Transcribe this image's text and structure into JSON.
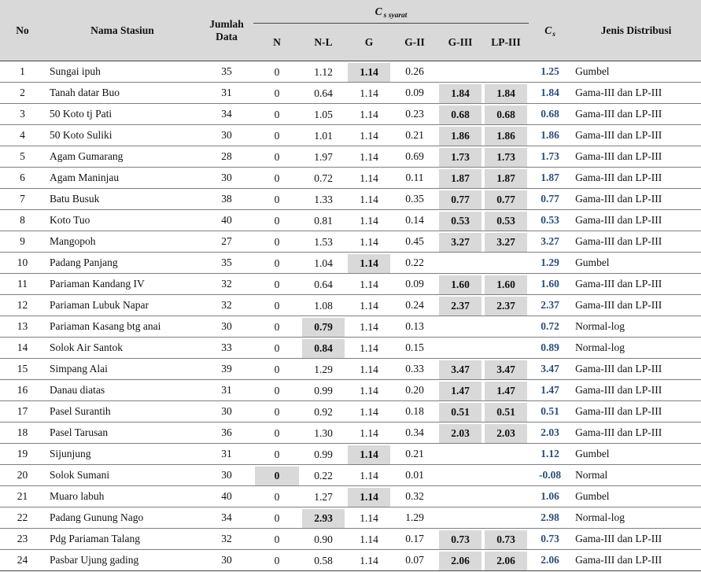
{
  "header": {
    "no": "No",
    "nama": "Nama Stasiun",
    "jumlah_line1": "Jumlah",
    "jumlah_line2": "Data",
    "cs_syarat_main": "C",
    "cs_syarat_sub": "s syarat",
    "n": "N",
    "nl": "N-L",
    "g": "G",
    "gii": "G-II",
    "giii": "G-III",
    "lpiii": "LP-III",
    "cs_main": "C",
    "cs_sub": "s",
    "jenis": "Jenis Distribusi"
  },
  "rows": [
    {
      "no": "1",
      "nama": "Sungai ipuh",
      "jumlah": "35",
      "n": "0",
      "nl": "1.12",
      "g": "1.14",
      "gii": "0.26",
      "giii": "",
      "lpiii": "",
      "cs": "1.25",
      "jenis": "Gumbel",
      "hl": [
        "g"
      ]
    },
    {
      "no": "2",
      "nama": "Tanah datar Buo",
      "jumlah": "31",
      "n": "0",
      "nl": "0.64",
      "g": "1.14",
      "gii": "0.09",
      "giii": "1.84",
      "lpiii": "1.84",
      "cs": "1.84",
      "jenis": "Gama-III dan LP-III",
      "hl": [
        "giii",
        "lpiii"
      ]
    },
    {
      "no": "3",
      "nama": "50 Koto tj Pati",
      "jumlah": "34",
      "n": "0",
      "nl": "1.05",
      "g": "1.14",
      "gii": "0.23",
      "giii": "0.68",
      "lpiii": "0.68",
      "cs": "0.68",
      "jenis": "Gama-III dan LP-III",
      "hl": [
        "giii",
        "lpiii"
      ]
    },
    {
      "no": "4",
      "nama": "50 Koto Suliki",
      "jumlah": "30",
      "n": "0",
      "nl": "1.01",
      "g": "1.14",
      "gii": "0.21",
      "giii": "1.86",
      "lpiii": "1.86",
      "cs": "1.86",
      "jenis": "Gama-III dan LP-III",
      "hl": [
        "giii",
        "lpiii"
      ]
    },
    {
      "no": "5",
      "nama": "Agam Gumarang",
      "jumlah": "28",
      "n": "0",
      "nl": "1.97",
      "g": "1.14",
      "gii": "0.69",
      "giii": "1.73",
      "lpiii": "1.73",
      "cs": "1.73",
      "jenis": "Gama-III dan LP-III",
      "hl": [
        "giii",
        "lpiii"
      ]
    },
    {
      "no": "6",
      "nama": "Agam Maninjau",
      "jumlah": "30",
      "n": "0",
      "nl": "0.72",
      "g": "1.14",
      "gii": "0.11",
      "giii": "1.87",
      "lpiii": "1.87",
      "cs": "1.87",
      "jenis": "Gama-III dan LP-III",
      "hl": [
        "giii",
        "lpiii"
      ]
    },
    {
      "no": "7",
      "nama": "Batu Busuk",
      "jumlah": "38",
      "n": "0",
      "nl": "1.33",
      "g": "1.14",
      "gii": "0.35",
      "giii": "0.77",
      "lpiii": "0.77",
      "cs": "0.77",
      "jenis": "Gama-III dan LP-III",
      "hl": [
        "giii",
        "lpiii"
      ]
    },
    {
      "no": "8",
      "nama": "Koto Tuo",
      "jumlah": "40",
      "n": "0",
      "nl": "0.81",
      "g": "1.14",
      "gii": "0.14",
      "giii": "0.53",
      "lpiii": "0.53",
      "cs": "0.53",
      "jenis": "Gama-III dan LP-III",
      "hl": [
        "giii",
        "lpiii"
      ]
    },
    {
      "no": "9",
      "nama": "Mangopoh",
      "jumlah": "27",
      "n": "0",
      "nl": "1.53",
      "g": "1.14",
      "gii": "0.45",
      "giii": "3.27",
      "lpiii": "3.27",
      "cs": "3.27",
      "jenis": "Gama-III dan LP-III",
      "hl": [
        "giii",
        "lpiii"
      ]
    },
    {
      "no": "10",
      "nama": "Padang Panjang",
      "jumlah": "35",
      "n": "0",
      "nl": "1.04",
      "g": "1.14",
      "gii": "0.22",
      "giii": "",
      "lpiii": "",
      "cs": "1.29",
      "jenis": "Gumbel",
      "hl": [
        "g"
      ]
    },
    {
      "no": "11",
      "nama": "Pariaman Kandang IV",
      "jumlah": "32",
      "n": "0",
      "nl": "0.64",
      "g": "1.14",
      "gii": "0.09",
      "giii": "1.60",
      "lpiii": "1.60",
      "cs": "1.60",
      "jenis": "Gama-III dan LP-III",
      "hl": [
        "giii",
        "lpiii"
      ]
    },
    {
      "no": "12",
      "nama": "Pariaman Lubuk Napar",
      "jumlah": "32",
      "n": "0",
      "nl": "1.08",
      "g": "1.14",
      "gii": "0.24",
      "giii": "2.37",
      "lpiii": "2.37",
      "cs": "2.37",
      "jenis": "Gama-III dan LP-III",
      "hl": [
        "giii",
        "lpiii"
      ]
    },
    {
      "no": "13",
      "nama": "Pariaman Kasang btg anai",
      "jumlah": "30",
      "n": "0",
      "nl": "0.79",
      "g": "1.14",
      "gii": "0.13",
      "giii": "",
      "lpiii": "",
      "cs": "0.72",
      "jenis": "Normal-log",
      "hl": [
        "nl"
      ]
    },
    {
      "no": "14",
      "nama": "Solok Air Santok",
      "jumlah": "33",
      "n": "0",
      "nl": "0.84",
      "g": "1.14",
      "gii": "0.15",
      "giii": "",
      "lpiii": "",
      "cs": "0.89",
      "jenis": "Normal-log",
      "hl": [
        "nl"
      ]
    },
    {
      "no": "15",
      "nama": "Simpang Alai",
      "jumlah": "39",
      "n": "0",
      "nl": "1.29",
      "g": "1.14",
      "gii": "0.33",
      "giii": "3.47",
      "lpiii": "3.47",
      "cs": "3.47",
      "jenis": "Gama-III dan LP-III",
      "hl": [
        "giii",
        "lpiii"
      ]
    },
    {
      "no": "16",
      "nama": "Danau diatas",
      "jumlah": "31",
      "n": "0",
      "nl": "0.99",
      "g": "1.14",
      "gii": "0.20",
      "giii": "1.47",
      "lpiii": "1.47",
      "cs": "1.47",
      "jenis": "Gama-III dan LP-III",
      "hl": [
        "giii",
        "lpiii"
      ]
    },
    {
      "no": "17",
      "nama": "Pasel Surantih",
      "jumlah": "30",
      "n": "0",
      "nl": "0.92",
      "g": "1.14",
      "gii": "0.18",
      "giii": "0.51",
      "lpiii": "0.51",
      "cs": "0.51",
      "jenis": "Gama-III dan LP-III",
      "hl": [
        "giii",
        "lpiii"
      ]
    },
    {
      "no": "18",
      "nama": "Pasel Tarusan",
      "jumlah": "36",
      "n": "0",
      "nl": "1.30",
      "g": "1.14",
      "gii": "0.34",
      "giii": "2.03",
      "lpiii": "2.03",
      "cs": "2.03",
      "jenis": "Gama-III dan LP-III",
      "hl": [
        "giii",
        "lpiii"
      ]
    },
    {
      "no": "19",
      "nama": "Sijunjung",
      "jumlah": "31",
      "n": "0",
      "nl": "0.99",
      "g": "1.14",
      "gii": "0.21",
      "giii": "",
      "lpiii": "",
      "cs": "1.12",
      "jenis": "Gumbel",
      "hl": [
        "g"
      ]
    },
    {
      "no": "20",
      "nama": "Solok Sumani",
      "jumlah": "30",
      "n": "0",
      "nl": "0.22",
      "g": "1.14",
      "gii": "0.01",
      "giii": "",
      "lpiii": "",
      "cs": "-0.08",
      "jenis": "Normal",
      "hl": [
        "n"
      ]
    },
    {
      "no": "21",
      "nama": "Muaro labuh",
      "jumlah": "40",
      "n": "0",
      "nl": "1.27",
      "g": "1.14",
      "gii": "0.32",
      "giii": "",
      "lpiii": "",
      "cs": "1.06",
      "jenis": "Gumbel",
      "hl": [
        "g"
      ]
    },
    {
      "no": "22",
      "nama": "Padang Gunung Nago",
      "jumlah": "34",
      "n": "0",
      "nl": "2.93",
      "g": "1.14",
      "gii": "1.29",
      "giii": "",
      "lpiii": "",
      "cs": "2.98",
      "jenis": "Normal-log",
      "hl": [
        "nl"
      ]
    },
    {
      "no": "23",
      "nama": "Pdg Pariaman Talang",
      "jumlah": "32",
      "n": "0",
      "nl": "0.90",
      "g": "1.14",
      "gii": "0.17",
      "giii": "0.73",
      "lpiii": "0.73",
      "cs": "0.73",
      "jenis": "Gama-III dan LP-III",
      "hl": [
        "giii",
        "lpiii"
      ]
    },
    {
      "no": "24",
      "nama": "Pasbar Ujung gading",
      "jumlah": "30",
      "n": "0",
      "nl": "0.58",
      "g": "1.14",
      "gii": "0.07",
      "giii": "2.06",
      "lpiii": "2.06",
      "cs": "2.06",
      "jenis": "Gama-III dan LP-III",
      "hl": [
        "giii",
        "lpiii"
      ]
    }
  ]
}
